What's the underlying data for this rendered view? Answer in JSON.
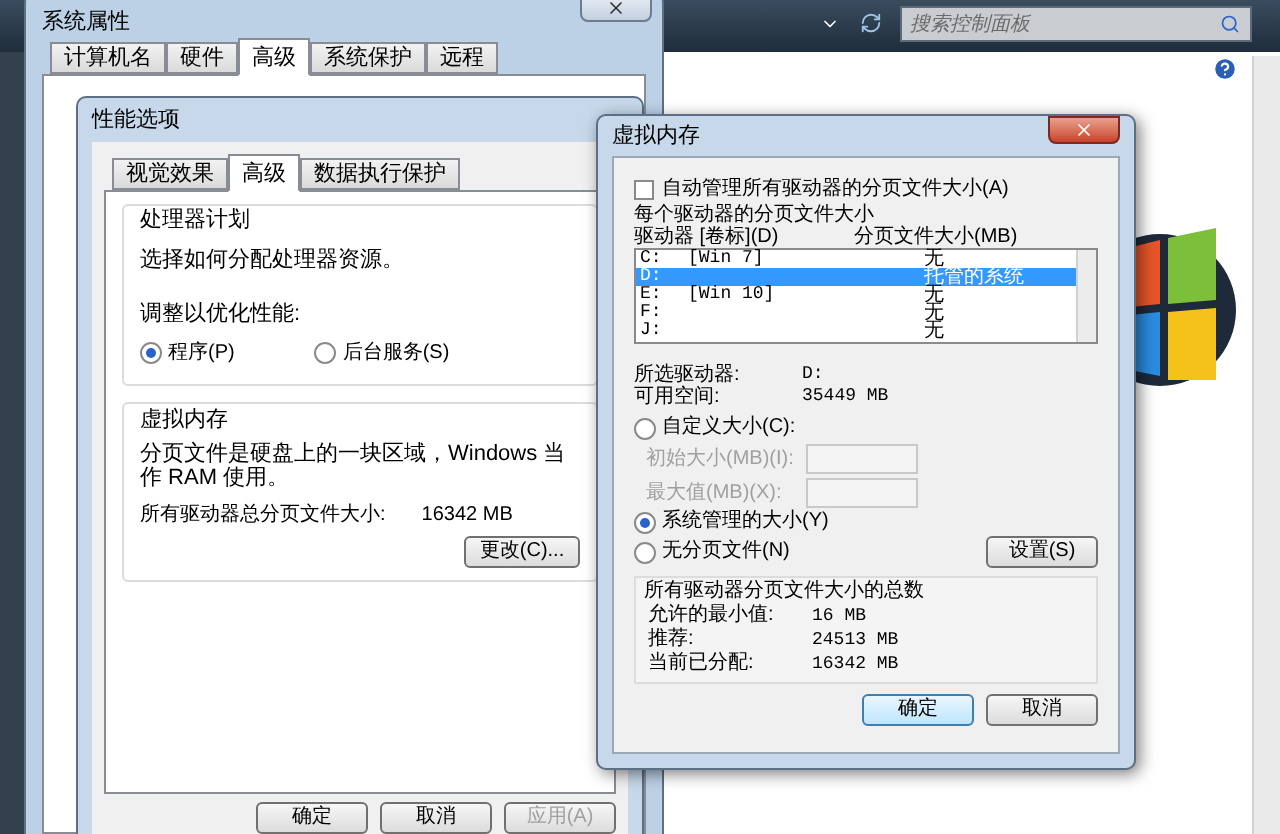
{
  "control_panel": {
    "search": {
      "placeholder": "搜索控制面板"
    }
  },
  "system_properties": {
    "title": "系统属性",
    "tabs": [
      {
        "label": "计算机名",
        "selected": false
      },
      {
        "label": "硬件",
        "selected": false
      },
      {
        "label": "高级",
        "selected": true
      },
      {
        "label": "系统保护",
        "selected": false
      },
      {
        "label": "远程",
        "selected": false
      }
    ]
  },
  "performance_options": {
    "title": "性能选项",
    "tabs": [
      {
        "label": "视觉效果",
        "selected": false
      },
      {
        "label": "高级",
        "selected": true
      },
      {
        "label": "数据执行保护",
        "selected": false
      }
    ],
    "processor_scheduling": {
      "heading": "处理器计划",
      "description": "选择如何分配处理器资源。",
      "adjust_label": "调整以优化性能:",
      "options": [
        {
          "label": "程序(P)",
          "selected": true
        },
        {
          "label": "后台服务(S)",
          "selected": false
        }
      ]
    },
    "virtual_memory": {
      "heading": "虚拟内存",
      "description": "分页文件是硬盘上的一块区域，Windows 当作 RAM 使用。",
      "total_label": "所有驱动器总分页文件大小:",
      "total_value": "16342 MB",
      "change_button": "更改(C)..."
    },
    "buttons": [
      {
        "label": "确定",
        "disabled": false
      },
      {
        "label": "取消",
        "disabled": false
      },
      {
        "label": "应用(A)",
        "disabled": true
      }
    ]
  },
  "virtual_memory_dialog": {
    "title": "虚拟内存",
    "auto_manage": {
      "label": "自动管理所有驱动器的分页文件大小(A)",
      "checked": false
    },
    "per_drive_heading": "每个驱动器的分页文件大小",
    "columns": [
      "驱动器 [卷标](D)",
      "分页文件大小(MB)"
    ],
    "drives": [
      {
        "drive": "C:",
        "label": "[Win 7]",
        "size": "无",
        "selected": false
      },
      {
        "drive": "D:",
        "size": "托管的系统",
        "selected": true
      },
      {
        "drive": "E:",
        "label": "[Win 10]",
        "size": "无",
        "selected": false
      },
      {
        "drive": "F:",
        "size": "无",
        "selected": false
      },
      {
        "drive": "J:",
        "size": "无",
        "selected": false
      }
    ],
    "info": [
      {
        "label": "所选驱动器:",
        "value": "D:"
      },
      {
        "label": "可用空间:",
        "value": "35449 MB"
      }
    ],
    "size_options": [
      {
        "kind": "custom",
        "label": "自定义大小(C):",
        "selected": false
      },
      {
        "kind": "system",
        "label": "系统管理的大小(Y)",
        "selected": true
      },
      {
        "kind": "none",
        "label": "无分页文件(N)",
        "selected": false
      }
    ],
    "fields": [
      {
        "label": "初始大小(MB)(I):",
        "disabled": true
      },
      {
        "label": "最大值(MB)(X):",
        "disabled": true
      }
    ],
    "set_button": "设置(S)",
    "totals": {
      "heading": "所有驱动器分页文件大小的总数",
      "rows": [
        {
          "label": "允许的最小值:",
          "value": "16 MB"
        },
        {
          "label": "推荐:",
          "value": "24513 MB"
        },
        {
          "label": "当前已分配:",
          "value": "16342 MB"
        }
      ]
    },
    "buttons": [
      {
        "label": "确定",
        "default": true
      },
      {
        "label": "取消",
        "default": false
      }
    ]
  }
}
